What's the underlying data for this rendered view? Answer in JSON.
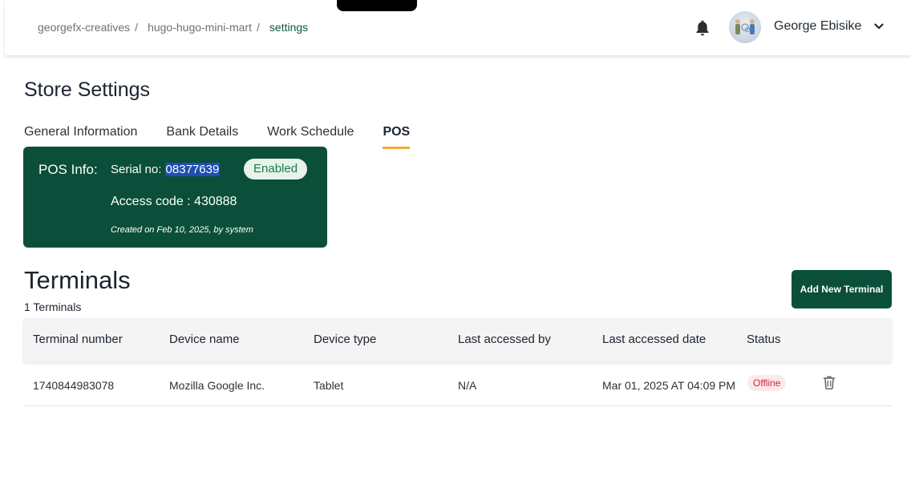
{
  "breadcrumb": {
    "items": [
      "georgefx-creatives",
      "hugo-hugo-mini-mart"
    ],
    "separator": "/",
    "current": "settings"
  },
  "user": {
    "name": "George Ebisike",
    "avatar_icon": "avatar-icon"
  },
  "page": {
    "title": "Store Settings"
  },
  "tabs": [
    {
      "label": "General Information",
      "active": false
    },
    {
      "label": "Bank Details",
      "active": false
    },
    {
      "label": "Work Schedule",
      "active": false
    },
    {
      "label": "POS",
      "active": true
    }
  ],
  "pos": {
    "label": "POS Info:",
    "serial_label": "Serial no:",
    "serial_value": "08377639",
    "status": "Enabled",
    "access_code": "Access code : 430888",
    "created": "Created on Feb 10, 2025, by system"
  },
  "terminals": {
    "title": "Terminals",
    "count": "1 Terminals",
    "add_button": "Add New Terminal",
    "columns": [
      "Terminal number",
      "Device name",
      "Device type",
      "Last accessed by",
      "Last accessed date",
      "Status"
    ],
    "rows": [
      {
        "terminal_number": "1740844983078",
        "device_name": "Mozilla Google Inc.",
        "device_type": "Tablet",
        "last_accessed_by": "N/A",
        "last_accessed_date": "Mar 01, 2025 AT 04:09 PM",
        "status": "Offline"
      }
    ]
  },
  "colors": {
    "brand_green": "#0b4f3a",
    "tab_underline": "#f2a93b",
    "offline_red": "#d02a3a",
    "enabled_green": "#207a4a"
  }
}
